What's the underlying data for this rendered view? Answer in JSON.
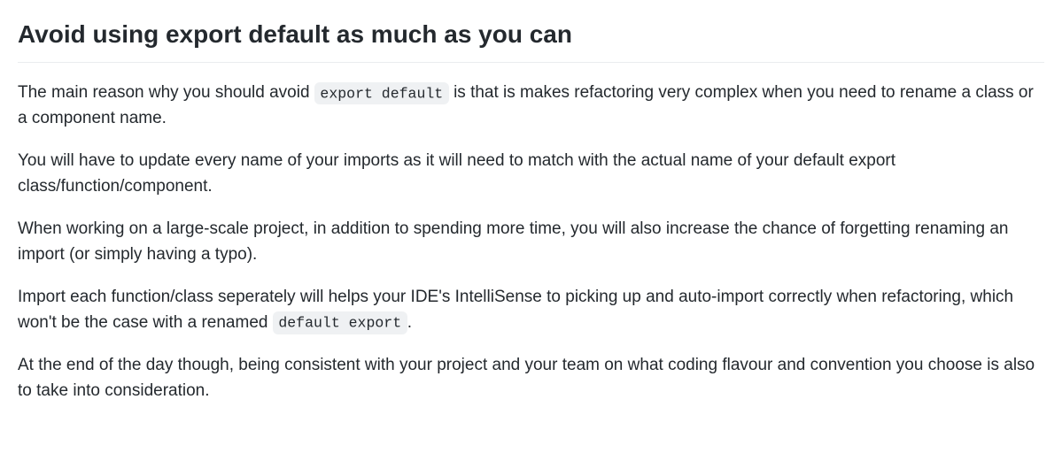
{
  "heading": "Avoid using export default as much as you can",
  "paragraphs": {
    "p1_a": "The main reason why you should avoid ",
    "p1_code": "export default",
    "p1_b": " is that is makes refactoring very complex when you need to rename a class or a component name.",
    "p2": "You will have to update every name of your imports as it will need to match with the actual name of your default export class/function/component.",
    "p3": "When working on a large-scale project, in addition to spending more time, you will also increase the chance of forgetting renaming an import (or simply having a typo).",
    "p4_a": "Import each function/class seperately will helps your IDE's IntelliSense to picking up and auto-import correctly when refactoring, which won't be the case with a renamed ",
    "p4_code": "default export",
    "p4_b": ".",
    "p5": "At the end of the day though, being consistent with your project and your team on what coding flavour and convention you choose is also to take into consideration."
  }
}
